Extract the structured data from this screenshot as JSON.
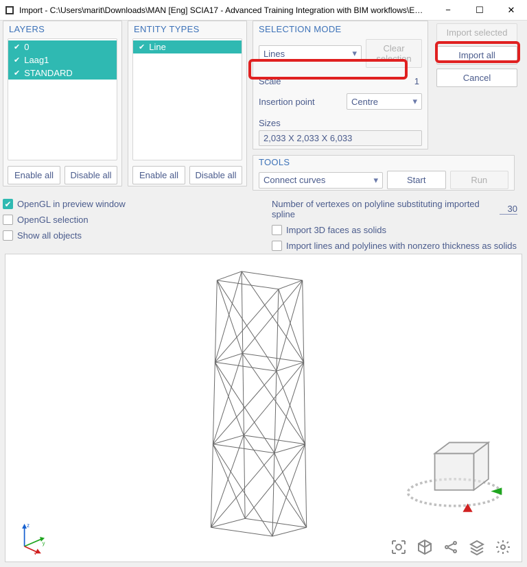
{
  "window": {
    "title": "Import - C:\\Users\\marit\\Downloads\\MAN [Eng] SCIA17 - Advanced Training Integration with BIM workflows\\Ex...",
    "controls": {
      "minimize": "−",
      "maximize": "☐",
      "close": "✕"
    }
  },
  "panels": {
    "layers": {
      "header": "LAYERS",
      "items": [
        "0",
        "Laag1",
        "STANDARD"
      ],
      "enable_all": "Enable all",
      "disable_all": "Disable all"
    },
    "entity_types": {
      "header": "ENTITY TYPES",
      "items": [
        "Line"
      ],
      "enable_all": "Enable all",
      "disable_all": "Disable all"
    },
    "selection": {
      "header": "SELECTION MODE",
      "mode": "Lines",
      "clear": "Clear selection",
      "scale_label": "Scale",
      "scale_value": "1",
      "insertion_label": "Insertion point",
      "insertion_value": "Centre",
      "sizes_label": "Sizes",
      "sizes_value": "2,033 X 2,033 X 6,033"
    },
    "tools": {
      "header": "TOOLS",
      "tool": "Connect curves",
      "start": "Start",
      "run": "Run"
    },
    "actions": {
      "import_selected": "Import selected",
      "import_all": "Import all",
      "cancel": "Cancel"
    }
  },
  "options": {
    "opengl_preview": "OpenGL in preview window",
    "opengl_selection": "OpenGL selection",
    "show_all": "Show all objects",
    "vertexes_label": "Number of vertexes on polyline substituting imported spline",
    "vertexes_value": "30",
    "faces_solids": "Import 3D faces as solids",
    "lines_solids": "Import lines and polylines with nonzero thickness as solids"
  },
  "axes": {
    "z": "z",
    "y": "y",
    "x": "x"
  }
}
